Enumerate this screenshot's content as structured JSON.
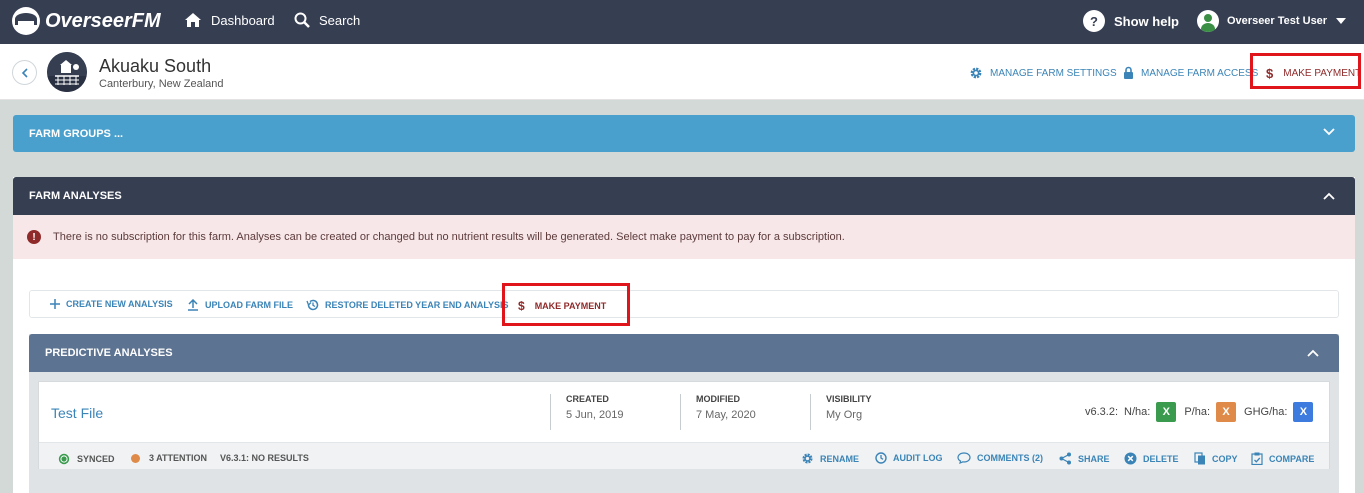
{
  "topnav": {
    "brand": "OverseerFM",
    "dashboard": "Dashboard",
    "search": "Search",
    "help": "Show help",
    "user": "Overseer Test User"
  },
  "farm": {
    "name": "Akuaku South",
    "location": "Canterbury, New Zealand",
    "manage_settings": "MANAGE FARM SETTINGS",
    "manage_access": "MANAGE FARM ACCESS",
    "make_payment": "MAKE PAYMENT"
  },
  "groups": {
    "title": "FARM GROUPS ..."
  },
  "analyses": {
    "title": "FARM ANALYSES",
    "alert": "There is no subscription for this farm. Analyses can be created or changed but no nutrient results will be generated. Select make payment to pay for a subscription.",
    "actions": {
      "create": "CREATE NEW ANALYSIS",
      "upload": "UPLOAD FARM FILE",
      "restore": "RESTORE DELETED YEAR END ANALYSIS",
      "pay": "MAKE PAYMENT"
    }
  },
  "predictive": {
    "title": "PREDICTIVE ANALYSES",
    "card": {
      "name": "Test File",
      "created_label": "CREATED",
      "created_value": "5 Jun, 2019",
      "modified_label": "MODIFIED",
      "modified_value": "7 May, 2020",
      "visibility_label": "VISIBILITY",
      "visibility_value": "My Org",
      "version": "v6.3.2:",
      "n_label": "N/ha:",
      "p_label": "P/ha:",
      "ghg_label": "GHG/ha:",
      "n_badge": "X",
      "p_badge": "X",
      "ghg_badge": "X",
      "synced": "SYNCED",
      "attention": "3 ATTENTION",
      "results": "V6.3.1: NO RESULTS",
      "rename": "RENAME",
      "audit": "AUDIT LOG",
      "comments": "COMMENTS (2)",
      "share": "SHARE",
      "delete": "DELETE",
      "copy": "COPY",
      "compare": "COMPARE"
    }
  },
  "colors": {
    "nav": "#363e52",
    "link": "#3b84b7",
    "pay": "#8f2a2a",
    "groups_bar": "#4aa0cd",
    "predictive_bar": "#5c7391",
    "badge_n": "#3a9b4f",
    "badge_p": "#e08a4a",
    "badge_ghg": "#3d7bde"
  }
}
